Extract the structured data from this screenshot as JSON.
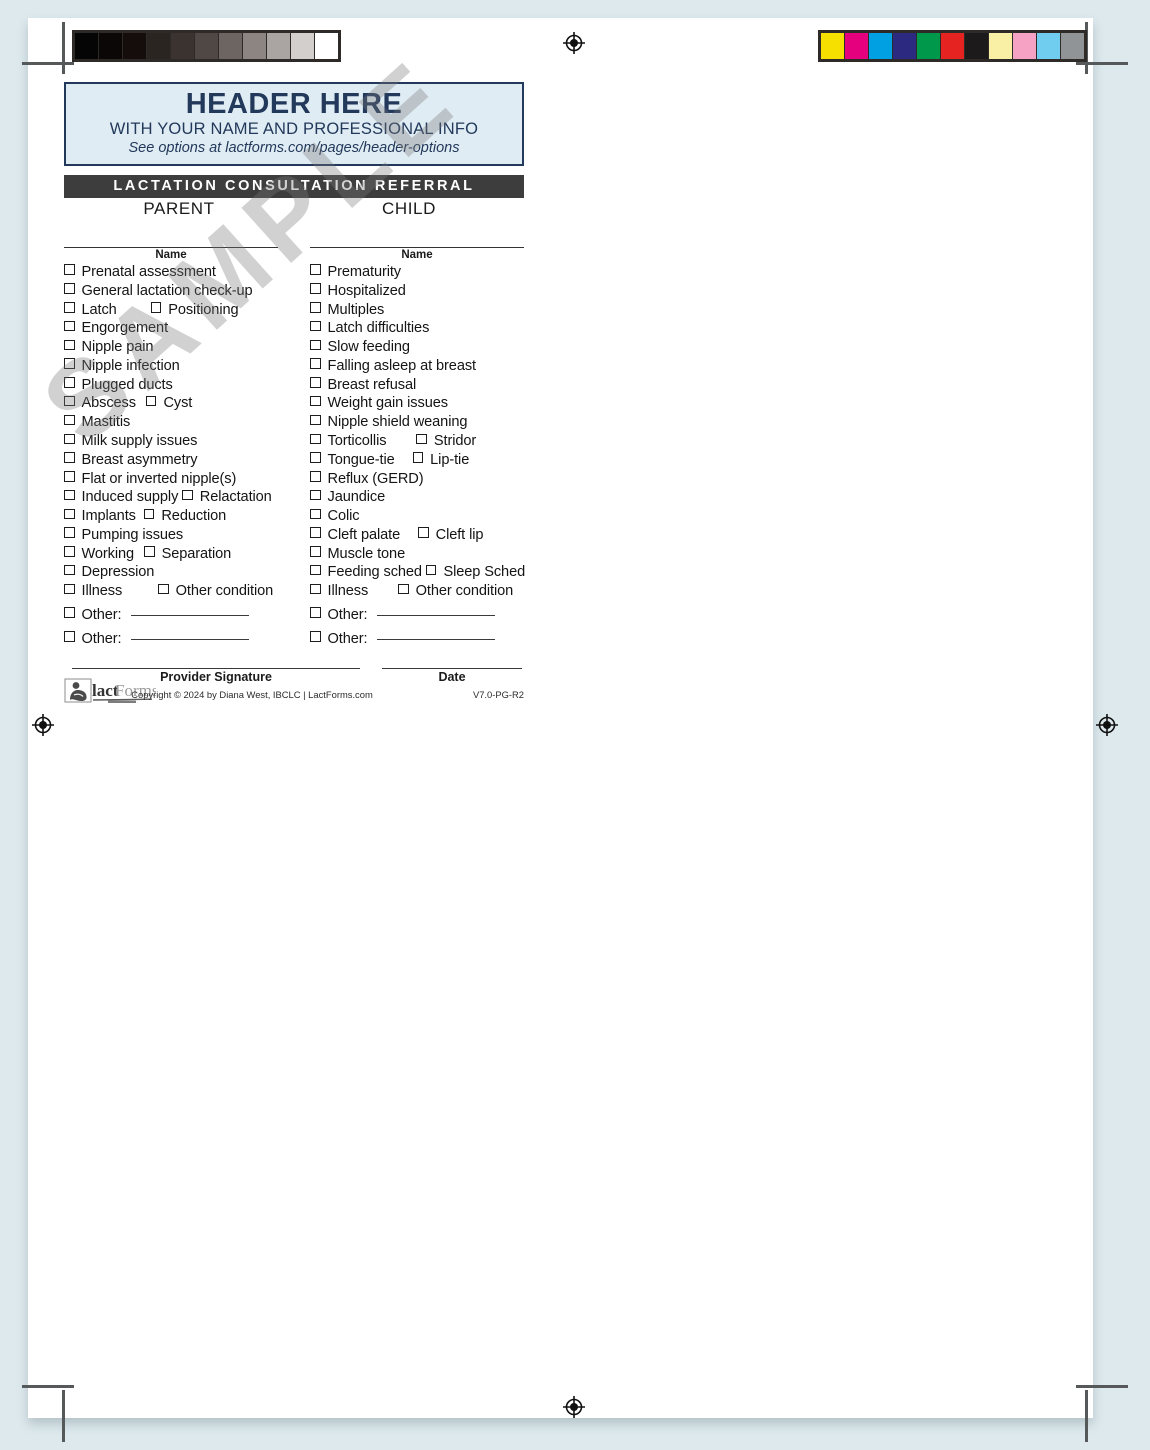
{
  "scan": {
    "grayscale_patches": [
      "#050505",
      "#0a0706",
      "#140d0b",
      "#2b2522",
      "#3a3330",
      "#4f4845",
      "#6d6562",
      "#8c8582",
      "#aaa5a2",
      "#d2cfcd",
      "#ffffff"
    ],
    "color_patches": [
      "#f5e000",
      "#e5007d",
      "#00a0e3",
      "#2b2a80",
      "#00984a",
      "#e52421",
      "#1c1a1a",
      "#faf0a5",
      "#f5a2c4",
      "#71cdf0",
      "#909497"
    ],
    "registration_marks": 4,
    "crop_marks": 4
  },
  "header": {
    "title": "HEADER HERE",
    "subtitle": "WITH YOUR NAME AND PROFESSIONAL INFO",
    "link": "See options at lactforms.com/pages/header-options",
    "border_color": "#23395b",
    "fill_color": "#dfecf3"
  },
  "form": {
    "title_bar": "LACTATION CONSULTATION REFERRAL",
    "title_bar_color": "#3d3d3d",
    "watermark": "SAMPLE",
    "columns": [
      {
        "heading": "PARENT",
        "name_label": "Name",
        "items": [
          {
            "label": "Prenatal assessment"
          },
          {
            "label": "General lactation check-up"
          },
          {
            "label": "Latch",
            "second": "Positioning",
            "gap": 34
          },
          {
            "label": "Engorgement"
          },
          {
            "label": "Nipple pain"
          },
          {
            "label": "Nipple infection"
          },
          {
            "label": "Plugged ducts"
          },
          {
            "label": "Abscess",
            "second": "Cyst",
            "gap": 10
          },
          {
            "label": "Mastitis"
          },
          {
            "label": "Milk supply issues"
          },
          {
            "label": "Breast asymmetry"
          },
          {
            "label": "Flat or inverted nipple(s)"
          },
          {
            "label": "Induced supply",
            "second": "Relactation",
            "gap": 4
          },
          {
            "label": "Implants",
            "second": "Reduction",
            "gap": 8
          },
          {
            "label": "Pumping issues"
          },
          {
            "label": "Working",
            "second": "Separation",
            "gap": 10
          },
          {
            "label": "Depression"
          },
          {
            "label": "Illness",
            "second": "Other condition",
            "gap": 36
          }
        ],
        "other_label": "Other:",
        "other_rows": 2
      },
      {
        "heading": "CHILD",
        "name_label": "Name",
        "items": [
          {
            "label": "Prematurity"
          },
          {
            "label": "Hospitalized"
          },
          {
            "label": "Multiples"
          },
          {
            "label": "Latch difficulties"
          },
          {
            "label": "Slow feeding"
          },
          {
            "label": "Falling asleep at breast"
          },
          {
            "label": "Breast refusal"
          },
          {
            "label": "Weight gain issues"
          },
          {
            "label": "Nipple shield weaning"
          },
          {
            "label": "Torticollis",
            "second": "Stridor",
            "gap": 30
          },
          {
            "label": "Tongue-tie",
            "second": "Lip-tie",
            "gap": 18
          },
          {
            "label": "Reflux (GERD)"
          },
          {
            "label": "Jaundice"
          },
          {
            "label": "Colic"
          },
          {
            "label": "Cleft palate",
            "second": "Cleft lip",
            "gap": 18
          },
          {
            "label": "Muscle tone"
          },
          {
            "label": "Feeding sched",
            "second": "Sleep Sched",
            "gap": 4
          },
          {
            "label": "Illness",
            "second": "Other condition",
            "gap": 30
          }
        ],
        "other_label": "Other:",
        "other_rows": 2
      }
    ]
  },
  "footer": {
    "provider_signature_label": "Provider Signature",
    "date_label": "Date",
    "copyright": "Copyright © 2024 by Diana West, IBCLC  |  LactForms.com",
    "version": "V7.0-PG-R2",
    "logo_text_a": "lact",
    "logo_text_b": "Forms"
  }
}
